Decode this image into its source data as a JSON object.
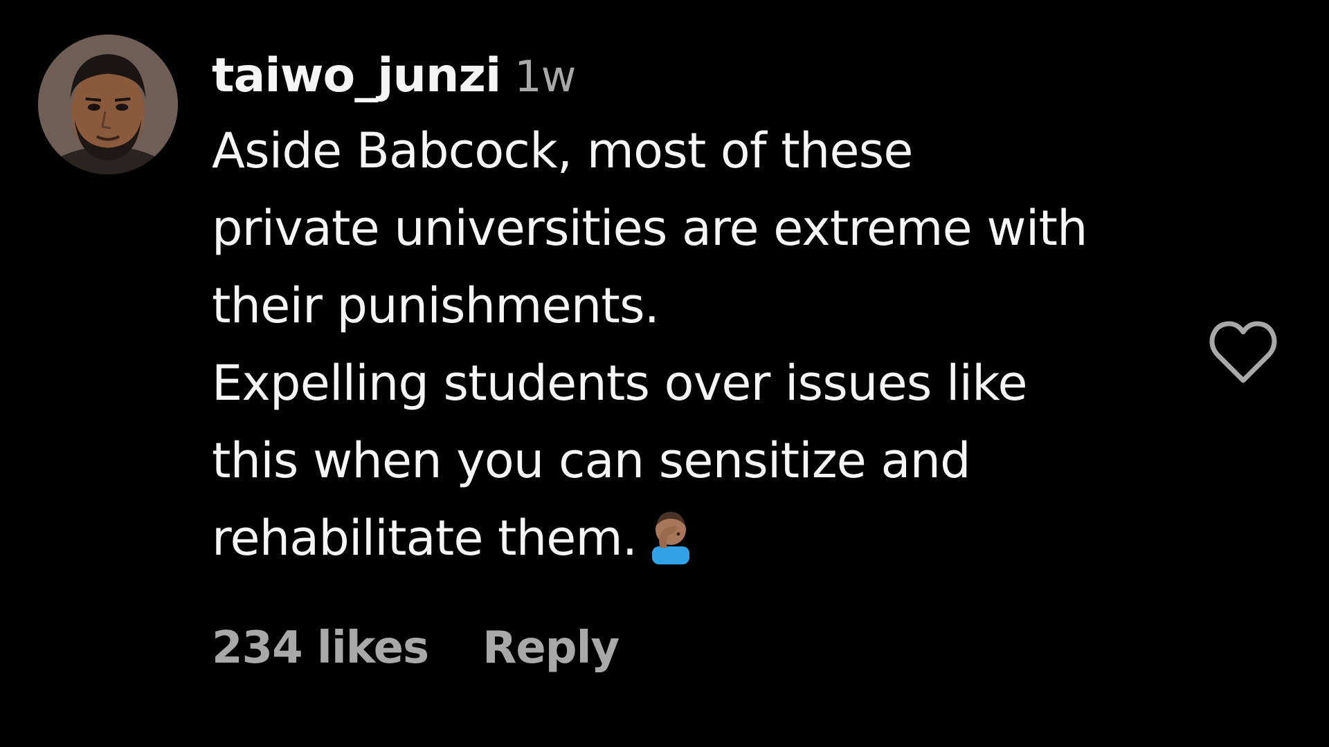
{
  "comment": {
    "username": "taiwo_junzi",
    "timestamp": "1w",
    "text_lines": [
      "Aside Babcock, most of these",
      "private universities are extreme with",
      "their punishments.",
      "Expelling students over issues like",
      "this when you can sensitize and",
      "rehabilitate them."
    ],
    "emoji_icon": "man-facepalming-emoji",
    "likes_label": "234 likes",
    "reply_label": "Reply",
    "like_icon": "heart-outline-icon"
  },
  "colors": {
    "background": "#000000",
    "primary_text": "#f5f5f5",
    "secondary_text": "#a8a8a8"
  }
}
